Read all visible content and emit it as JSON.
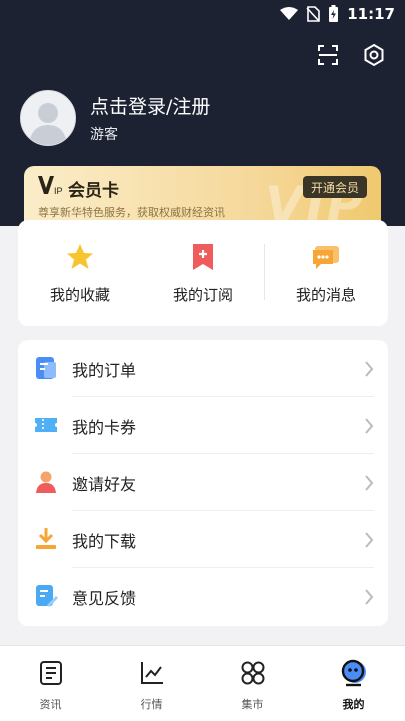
{
  "status_bar": {
    "time": "11:17"
  },
  "header": {
    "login_title": "点击登录/注册",
    "login_subtitle": "游客"
  },
  "vip": {
    "logo_text": "VIP",
    "title": "会员卡",
    "description": "尊享新华特色服务，获取权威财经资讯",
    "open_button": "开通会员",
    "watermark": "VIP"
  },
  "quick_actions": [
    {
      "label": "我的收藏",
      "icon": "star-icon"
    },
    {
      "label": "我的订阅",
      "icon": "subscribe-icon"
    },
    {
      "label": "我的消息",
      "icon": "message-icon"
    }
  ],
  "menu": [
    {
      "label": "我的订单",
      "icon": "order-icon"
    },
    {
      "label": "我的卡券",
      "icon": "coupon-icon"
    },
    {
      "label": "邀请好友",
      "icon": "invite-icon"
    },
    {
      "label": "我的下载",
      "icon": "download-icon"
    },
    {
      "label": "意见反馈",
      "icon": "feedback-icon"
    }
  ],
  "tabs": [
    {
      "label": "资讯",
      "icon": "news-icon"
    },
    {
      "label": "行情",
      "icon": "market-icon"
    },
    {
      "label": "集市",
      "icon": "bazaar-icon"
    },
    {
      "label": "我的",
      "icon": "profile-icon",
      "active": true
    }
  ],
  "colors": {
    "header_bg": "#1d2233",
    "vip_gold": "#f5d89a",
    "accent_blue": "#4a8df6",
    "accent_red": "#f05b5b",
    "accent_orange": "#f7a534"
  }
}
